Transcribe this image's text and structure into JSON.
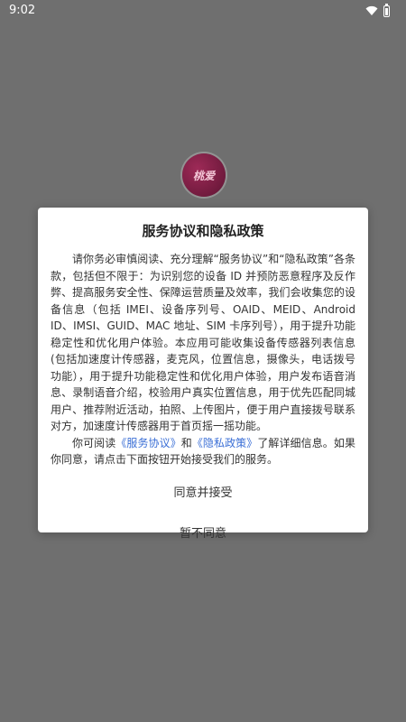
{
  "status_bar": {
    "time": "9:02"
  },
  "app_logo_text": "桃爱",
  "dialog": {
    "title": "服务协议和隐私政策",
    "paragraph1": "请你务必审慎阅读、充分理解“服务协议”和“隐私政策”各条款，包括但不限于：为识别您的设备 ID 并预防恶意程序及反作弊、提高服务安全性、保障运营质量及效率，我们会收集您的设备信息（包括 IMEI、设备序列号、OAID、MEID、Android ID、IMSI、GUID、MAC 地址、SIM 卡序列号），用于提升功能稳定性和优化用户体验。本应用可能收集设备传感器列表信息(包括加速度计传感器，麦克风，位置信息，摄像头，电话拨号功能），用于提升功能稳定性和优化用户体验，用户发布语音消息、录制语音介绍，校验用户真实位置信息，用于优先匹配同城用户、推荐附近活动，拍照、上传图片，便于用户直接拨号联系对方，加速度计传感器用于首页摇一摇功能。",
    "paragraph2_prefix": "你可阅读",
    "service_link": "《服务协议》",
    "paragraph2_and": "和",
    "privacy_link": "《隐私政策》",
    "paragraph2_suffix": "了解详细信息。如果你同意，请点击下面按钮开始接受我们的服务。",
    "agree_label": "同意并接受",
    "disagree_label": "暂不同意"
  }
}
